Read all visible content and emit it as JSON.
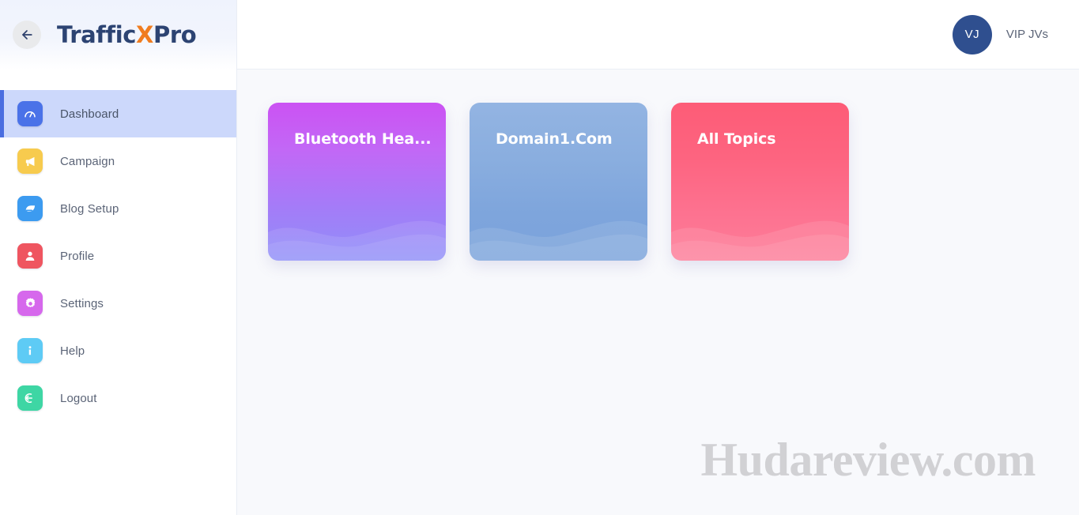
{
  "brand": {
    "name_part1": "Traffic",
    "name_x": "X",
    "name_part2": "Pro",
    "back_icon": "arrow-left-icon"
  },
  "sidebar": {
    "items": [
      {
        "label": "Dashboard",
        "icon": "speedometer-icon",
        "active": true,
        "icon_color": "#4a72e8"
      },
      {
        "label": "Campaign",
        "icon": "megaphone-icon",
        "active": false,
        "icon_color": "#f7cb4e"
      },
      {
        "label": "Blog Setup",
        "icon": "blog-pen-icon",
        "active": false,
        "icon_color": "#3c9bf0"
      },
      {
        "label": "Profile",
        "icon": "user-icon",
        "active": false,
        "icon_color": "#ef5560"
      },
      {
        "label": "Settings",
        "icon": "gear-icon",
        "active": false,
        "icon_color": "#d668ec"
      },
      {
        "label": "Help",
        "icon": "info-icon",
        "active": false,
        "icon_color": "#5ecbf5"
      },
      {
        "label": "Logout",
        "icon": "logout-icon",
        "active": false,
        "icon_color": "#3ed6a4"
      }
    ]
  },
  "topbar": {
    "avatar_initials": "VJ",
    "user_name": "VIP JVs"
  },
  "main": {
    "cards": [
      {
        "title": "Bluetooth Hea...",
        "accent": "#c45ef5"
      },
      {
        "title": "Domain1.Com",
        "accent": "#8aaedf"
      },
      {
        "title": "All Topics",
        "accent": "#fd6480"
      }
    ]
  },
  "watermark": {
    "text": "Hudareview.com"
  }
}
